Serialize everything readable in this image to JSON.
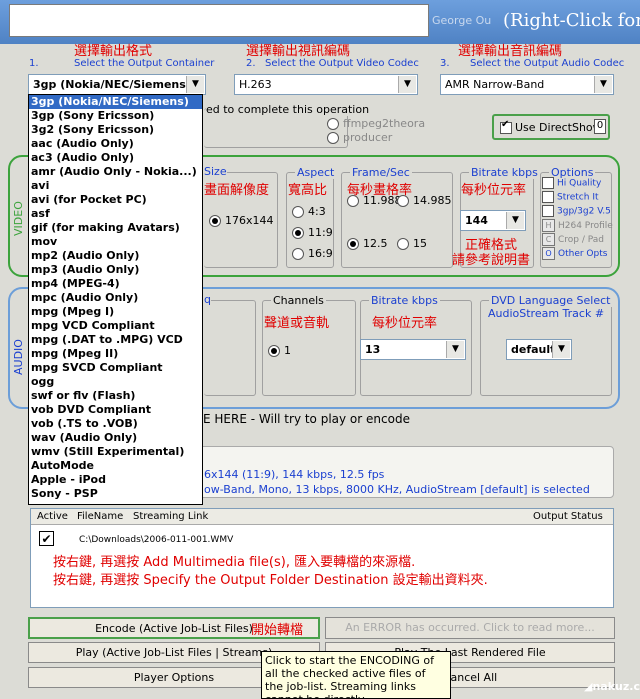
{
  "window": {
    "title_right": "(Right-Click for M",
    "author": "George Ou"
  },
  "steps": [
    {
      "num": "1.",
      "red": "選擇輸出格式",
      "blue": "Select the Output Container"
    },
    {
      "num": "2.",
      "red": "選擇輸出視訊編碼",
      "blue": "Select the Output Video Codec"
    },
    {
      "num": "3.",
      "red": "選擇輸出音訊編碼",
      "blue": "Select the Output Audio Codec"
    }
  ],
  "combos": {
    "container": "3gp  (Nokia/NEC/Siemens)",
    "video_codec": "H.263",
    "audio_codec": "AMR Narrow-Band"
  },
  "container_options": [
    "3gp  (Nokia/NEC/Siemens)",
    "3gp  (Sony Ericsson)",
    "3g2  (Sony Ericsson)",
    "aac  (Audio Only)",
    "ac3  (Audio Only)",
    "amr  (Audio Only - Nokia...)",
    "avi",
    "avi  (for Pocket PC)",
    "asf",
    "gif  (for making Avatars)",
    "mov",
    "mp2  (Audio Only)",
    "mp3  (Audio Only)",
    "mp4  (MPEG-4)",
    "mpc  (Audio Only)",
    "mpg  (Mpeg I)",
    "mpg  VCD Compliant",
    "mpg  (.DAT to .MPG) VCD",
    "mpg  (Mpeg II)",
    "mpg  SVCD Compliant",
    "ogg",
    "swf or flv (Flash)",
    "vob  DVD Compliant",
    "vob  (.TS to .VOB)",
    "wav  (Audio Only)",
    "wmv  (Still Experimental)",
    "AutoMode",
    "Apple - iPod",
    "Sony - PSP"
  ],
  "encoder_row": {
    "partial_text": "ed to complete this operation",
    "ffmpeg2theora": "ffmpeg2theora",
    "producer": "producer",
    "directshow": "Use DirectShow",
    "directshow_num": "0"
  },
  "video": {
    "side_label": "VIDEO",
    "size": {
      "label": "Size",
      "red": "畫面解像度",
      "value": "176x144"
    },
    "aspect": {
      "label": "Aspect",
      "red": "寬高比",
      "options": [
        "4:3",
        "11:9",
        "16:9"
      ]
    },
    "framerate": {
      "label": "Frame/Sec",
      "red": "每秒畫格率",
      "options": [
        "11.988",
        "14.985",
        "12.5",
        "15"
      ]
    },
    "bitrate": {
      "label": "Bitrate  kbps",
      "red": "每秒位元率",
      "value": "144",
      "red_note1": "正確格式",
      "red_note2": "請參考說明書"
    },
    "options": {
      "label": "Options",
      "items": [
        "Hi Quality",
        "Stretch It",
        "3gp/3g2 V.5",
        "H264 Profile",
        "Crop / Pad",
        "Other Opts"
      ],
      "marks": [
        "H",
        "C",
        "O"
      ]
    }
  },
  "audio": {
    "side_label": "AUDIO",
    "partial_label": "q",
    "channels": {
      "label": "Channels",
      "red": "聲道或音軌",
      "value": "1"
    },
    "bitrate": {
      "label": "Bitrate  kbps",
      "red": "每秒位元率",
      "value": "13"
    },
    "dvd": {
      "label": "DVD Language Select",
      "label2": "AudioStream  Track #",
      "value": "default"
    }
  },
  "drop_here": "E HERE - Will try to play or encode",
  "summary": {
    "line1": "6x144 (11:9), 144 kbps, 12.5 fps",
    "line2": "ow-Band, Mono, 13 kbps, 8000 KHz, AudioStream [default] is selected"
  },
  "joblist": {
    "headers": [
      "Active",
      "FileName",
      "Streaming Link",
      "Output Status"
    ],
    "file": "C:\\Downloads\\2006-011-001.WMV",
    "note1": "按右鍵, 再選按 Add Multimedia file(s), 匯入要轉檔的來源檔.",
    "note2": "按右鍵, 再選按  Specify the Output Folder Destination 設定輸出資料夾."
  },
  "buttons": {
    "encode": "Encode (Active Job-List Files)",
    "encode_red": "開始轉檔",
    "error": "An ERROR has occurred. Click to read more...",
    "play": "Play (Active Job-List Files | Streams)",
    "play_last": "Play The Last Rendered File",
    "player_options": "Player Options",
    "cancel_all": "Cancel All"
  },
  "tooltip": "Click to start the ENCODING of all the checked active files of the job-list. Streaming links cannot be directly",
  "watermark": "nakuz.com"
}
